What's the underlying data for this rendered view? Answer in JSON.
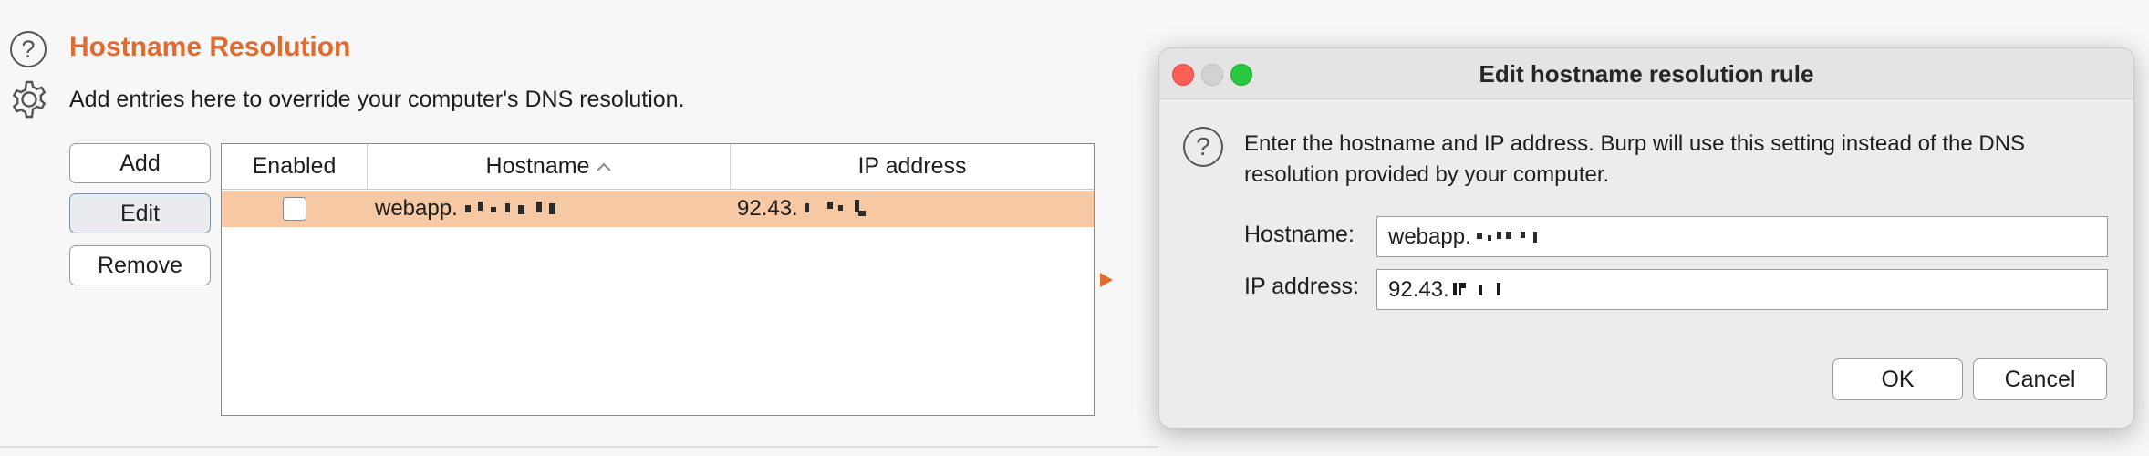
{
  "section": {
    "title": "Hostname Resolution",
    "description": "Add entries here to override your computer's DNS resolution."
  },
  "buttons": {
    "add": "Add",
    "edit": "Edit",
    "remove": "Remove"
  },
  "table": {
    "columns": [
      "Enabled",
      "Hostname",
      "IP address"
    ],
    "sort_column": "Hostname",
    "sort_direction": "ascending",
    "rows": [
      {
        "enabled": false,
        "hostname": "webapp.",
        "ip": "92.43.",
        "selected": true
      }
    ]
  },
  "dialog": {
    "title": "Edit hostname resolution rule",
    "message": "Enter the hostname and IP address. Burp will use this setting instead of the DNS resolution provided by your computer.",
    "hostname_label": "Hostname:",
    "hostname_value": "webapp.",
    "ip_label": "IP address:",
    "ip_value": "92.43.",
    "ok": "OK",
    "cancel": "Cancel"
  },
  "colors": {
    "accent": "#e06b2f",
    "selected_row": "#f6c8a3",
    "close": "#fe5f57",
    "maximize": "#28c840"
  }
}
